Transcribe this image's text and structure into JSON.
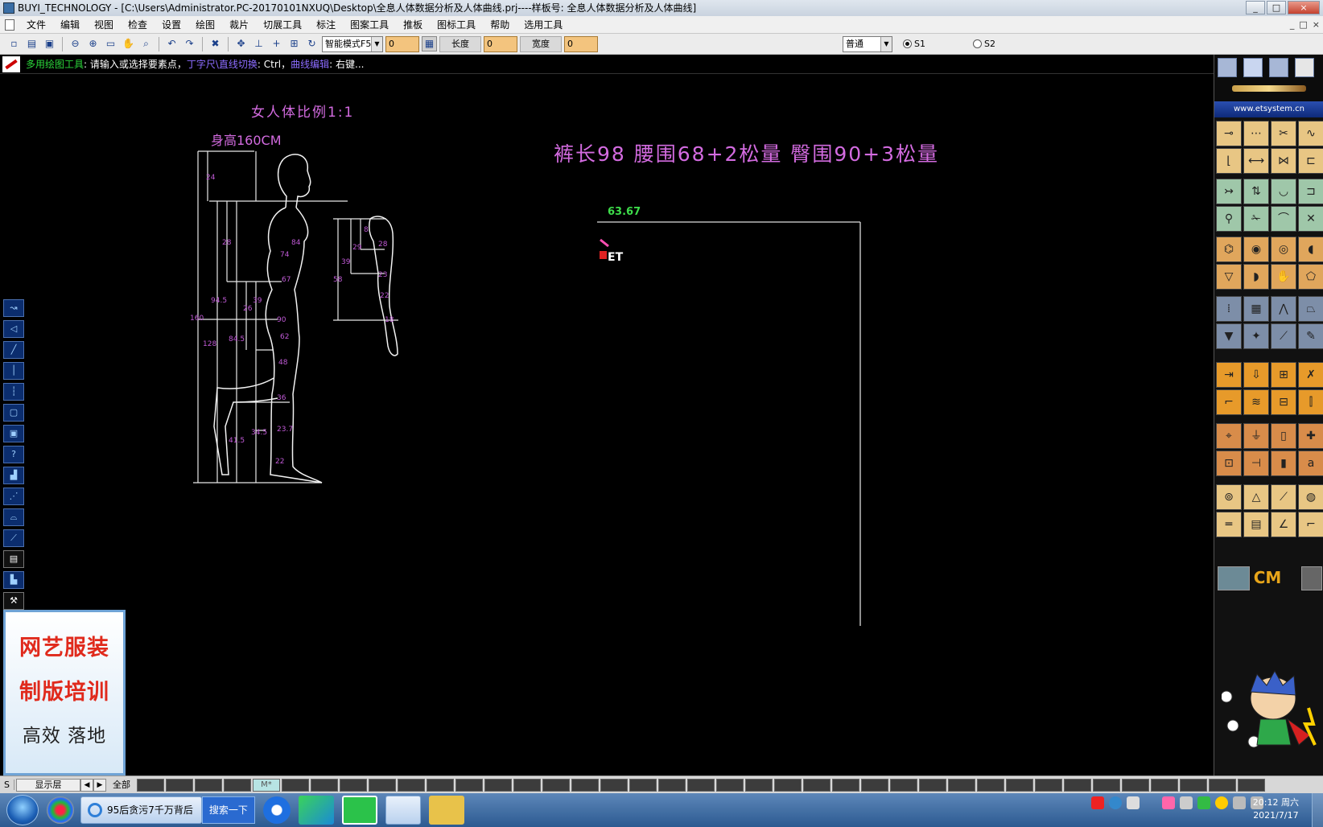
{
  "window": {
    "title": "BUYI_TECHNOLOGY - [C:\\Users\\Administrator.PC-20170101NXUQ\\Desktop\\全息人体数据分析及人体曲线.prj----样板号: 全息人体数据分析及人体曲线]",
    "controls": [
      "_",
      "□",
      "×"
    ]
  },
  "menu": [
    "文件",
    "编辑",
    "视图",
    "检查",
    "设置",
    "绘图",
    "裁片",
    "切展工具",
    "标注",
    "图案工具",
    "推板",
    "图标工具",
    "帮助",
    "选用工具"
  ],
  "mdi_controls": [
    "_",
    "□",
    "×"
  ],
  "toolbar": {
    "mode_select": "智能模式F5",
    "field_value": "0",
    "length_label": "长度",
    "length_value": "0",
    "width_label": "宽度",
    "width_value": "0",
    "style_select": "普通",
    "radio_s1": "S1",
    "radio_s2": "S2"
  },
  "hint": {
    "tool": "多用绘图工具",
    "tool_text": ": 请输入或选择要素点，",
    "ruler": "丁字尺\\直线切换",
    "ruler_text": ": Ctrl，",
    "curve": "曲线编辑",
    "curve_text": ": 右键..."
  },
  "canvas": {
    "figure_title": "女人体比例1:1",
    "height_label": "身高160CM",
    "spec_text": "裤长98  腰围68+2松量  臀围90+3松量",
    "line_length": "63.67",
    "cursor_label": "ET",
    "body_dims": [
      "24",
      "28",
      "94.5",
      "39",
      "26",
      "84.5",
      "128",
      "160",
      "41.5",
      "34.5",
      "84",
      "74",
      "67",
      "90",
      "62",
      "48",
      "36",
      "23.7",
      "22",
      "8",
      "29",
      "28",
      "39",
      "58",
      "23",
      "22",
      "18"
    ]
  },
  "ad": {
    "line1": "网艺服装",
    "line2": "制版培训",
    "line3": "高效  落地"
  },
  "rightpanel": {
    "url": "www.etsystem.cn",
    "cm_label": "CM"
  },
  "statusbar": {
    "s": "S",
    "layer": "显示层",
    "all": "全部",
    "active_cell": "M*"
  },
  "taskbar": {
    "task_label": "95后贪污7千万背后",
    "search_label": "搜索一下",
    "time": "20:12 周六",
    "date": "2021/7/17"
  }
}
